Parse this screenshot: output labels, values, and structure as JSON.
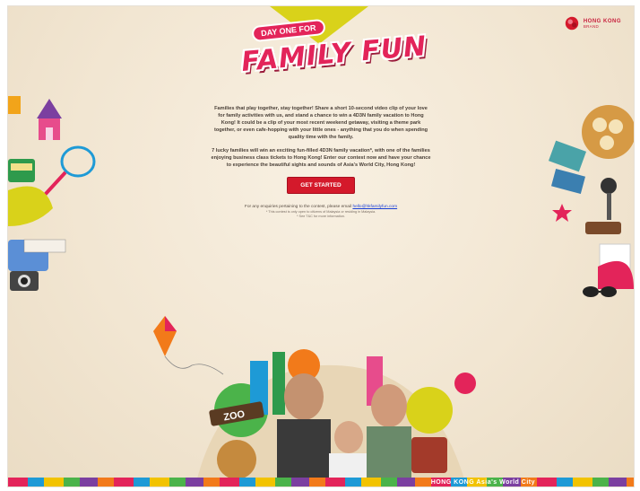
{
  "header": {
    "logo_top": "DAY ONE FOR",
    "logo_main": "FAMILY FUN",
    "brand_line1": "HONG KONG",
    "brand_line2": "BRAND"
  },
  "main": {
    "paragraph1": "Families that play together, stay together! Share a short 10-second video clip of your love for family activities with us, and stand a chance to win a 4D3N family vacation to Hong Kong! It could be a clip of your most recent weekend getaway, visiting a theme park together, or even cafe-hopping with your little ones - anything that you do when spending quality time with the family.",
    "paragraph2": "7 lucky families will win an exciting fun-filled 4D3N family vacation*, with one of the families enjoying business class tickets to Hong Kong! Enter our contest now and have your chance to experience the beautiful sights and sounds of Asia's World City, Hong Kong!",
    "cta_label": "GET STARTED",
    "enquiry_prefix": "For any enquiries pertaining to the contest, please email",
    "enquiry_email": "hello@hkfamilyfun.com",
    "fine1": "* This contest is only open to citizens of Malaysia or residing in Malaysia.",
    "fine2": "* See T&C for more information."
  },
  "footer": {
    "strip_text": "HONG KONG  Asia's World City"
  },
  "colors": {
    "accent": "#e3245a",
    "cta": "#d4192b",
    "background": "#f2e6d2",
    "top_triangle": "#d9d21a"
  },
  "icons": [
    "castle-icon",
    "tram-icon",
    "badminton-racket-icon",
    "camera-icon",
    "kite-icon",
    "food-bowl-icon",
    "microphone-icon",
    "ticket-icon",
    "sunglasses-icon",
    "zoo-sign-icon",
    "family-photo"
  ]
}
